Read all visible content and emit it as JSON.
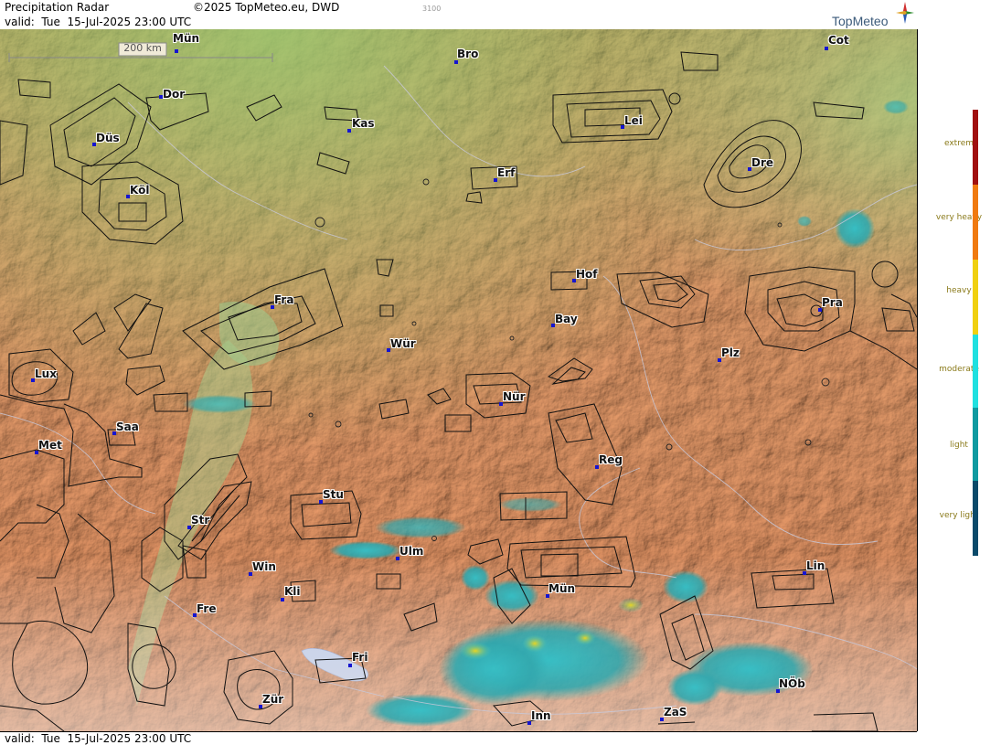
{
  "header": {
    "title": "Precipitation Radar",
    "copyright": "©2025 TopMeteo.eu, DWD",
    "code": "3100",
    "valid": "valid:  Tue  15-Jul-2025 23:00 UTC",
    "logo": "TopMeteo"
  },
  "footer": {
    "valid": "valid:  Tue  15-Jul-2025 23:00 UTC"
  },
  "scale": {
    "label": "200 km"
  },
  "legend": {
    "levels": [
      {
        "label": "extrem",
        "color": "#a01010"
      },
      {
        "label": "very heavy",
        "color": "#f07a10"
      },
      {
        "label": "heavy",
        "color": "#f0d010"
      },
      {
        "label": "moderate",
        "color": "#20e0e0"
      },
      {
        "label": "light",
        "color": "#109aa0"
      },
      {
        "label": "very light",
        "color": "#0a4a6a"
      }
    ]
  },
  "cities": [
    {
      "name": "Mün",
      "id": "muenster"
    },
    {
      "name": "Dor"
    },
    {
      "name": "Düs"
    },
    {
      "name": "Köl"
    },
    {
      "name": "Kas"
    },
    {
      "name": "Bro"
    },
    {
      "name": "Erf"
    },
    {
      "name": "Lei"
    },
    {
      "name": "Cot"
    },
    {
      "name": "Dre"
    },
    {
      "name": "Hof"
    },
    {
      "name": "Fra"
    },
    {
      "name": "Bay"
    },
    {
      "name": "Wür"
    },
    {
      "name": "Pra"
    },
    {
      "name": "Lux"
    },
    {
      "name": "Plz"
    },
    {
      "name": "Nür"
    },
    {
      "name": "Saa"
    },
    {
      "name": "Met"
    },
    {
      "name": "Reg"
    },
    {
      "name": "Stu"
    },
    {
      "name": "Str"
    },
    {
      "name": "Ulm"
    },
    {
      "name": "Win"
    },
    {
      "name": "Kli"
    },
    {
      "name": "Mün"
    },
    {
      "name": "Lin"
    },
    {
      "name": "Fre"
    },
    {
      "name": "Fri"
    },
    {
      "name": "NÖb"
    },
    {
      "name": "Zür"
    },
    {
      "name": "Inn"
    },
    {
      "name": "ZaS"
    }
  ]
}
